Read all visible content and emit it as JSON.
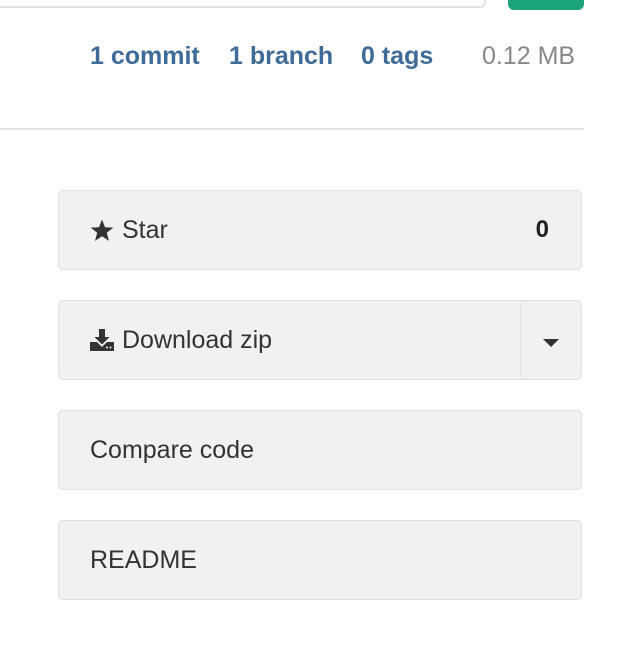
{
  "stats": {
    "commits": "1 commit",
    "branches": "1 branch",
    "tags": "0 tags",
    "size": "0.12 MB"
  },
  "actions": {
    "star_label": "Star",
    "star_count": "0",
    "star_icon": "star-icon",
    "download_label": "Download zip",
    "download_icon": "download-icon",
    "download_menu_icon": "caret-down-icon",
    "compare_label": "Compare code",
    "readme_label": "README"
  },
  "colors": {
    "link": "#3e6b97",
    "accent_green": "#1ba37a",
    "button_bg": "#f1f1f1"
  }
}
